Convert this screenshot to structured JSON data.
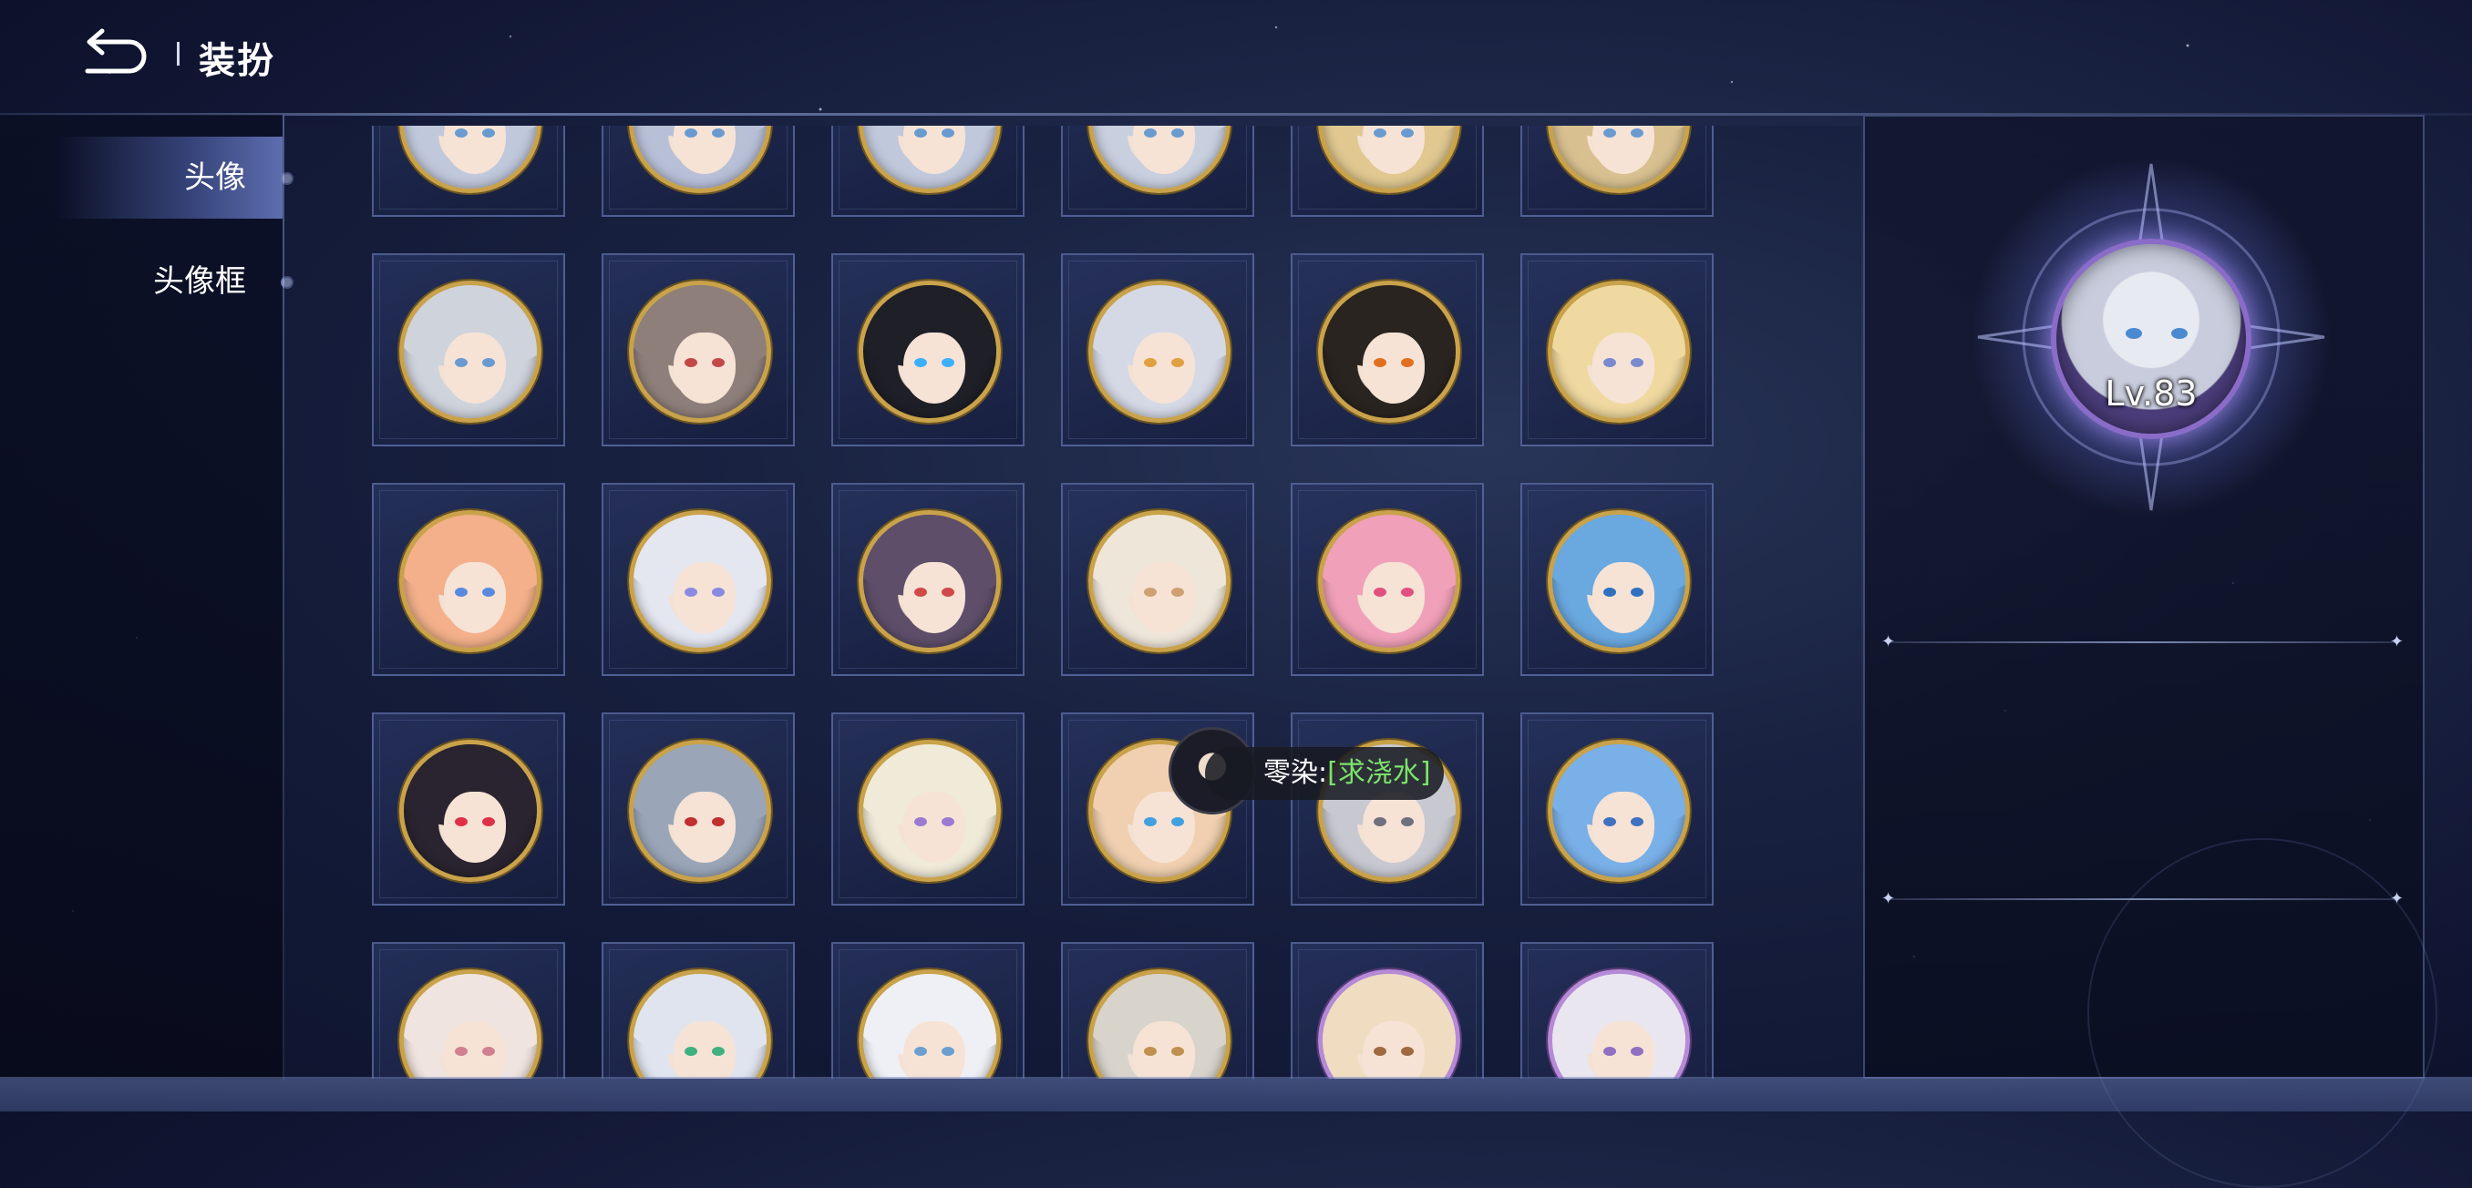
{
  "header": {
    "title": "装扮"
  },
  "sidebar": {
    "items": [
      {
        "label": "头像",
        "active": true
      },
      {
        "label": "头像框",
        "active": false
      }
    ]
  },
  "tooltip": {
    "name": "零染:",
    "tag": "[求浇水]"
  },
  "preview": {
    "level": "Lv.83"
  },
  "colors": {
    "accent": "#c9a24a",
    "tooltip_tag": "#7be36b",
    "panel_border": "#6e80be"
  },
  "avatars": [
    {
      "hair": "#cfd3dc",
      "eye": "#6a9bd0",
      "frame": "gold"
    },
    {
      "hair": "#8e7f7a",
      "eye": "#c24848",
      "frame": "gold"
    },
    {
      "hair": "#1f1f28",
      "eye": "#3bb0ff",
      "frame": "gold"
    },
    {
      "hair": "#d5d9e6",
      "eye": "#e0a040",
      "frame": "gold"
    },
    {
      "hair": "#2a2420",
      "eye": "#e07020",
      "frame": "gold"
    },
    {
      "hair": "#f0d9a0",
      "eye": "#7a8ad0",
      "frame": "gold"
    },
    {
      "hair": "#f3b08a",
      "eye": "#5a8ae0",
      "frame": "gold"
    },
    {
      "hair": "#e4e6f0",
      "eye": "#8a8ae0",
      "frame": "gold"
    },
    {
      "hair": "#5e4e6a",
      "eye": "#d04848",
      "frame": "gold"
    },
    {
      "hair": "#efe6da",
      "eye": "#d0a070",
      "frame": "gold"
    },
    {
      "hair": "#f0a0b8",
      "eye": "#e05080",
      "frame": "gold"
    },
    {
      "hair": "#6aa8e0",
      "eye": "#3070c0",
      "frame": "gold"
    },
    {
      "hair": "#2a2430",
      "eye": "#e03048",
      "frame": "gold"
    },
    {
      "hair": "#9aa6b8",
      "eye": "#c03030",
      "frame": "gold"
    },
    {
      "hair": "#f0ead8",
      "eye": "#9a7ad0",
      "frame": "gold"
    },
    {
      "hair": "#f0d0b0",
      "eye": "#40a0e0",
      "frame": "gold"
    },
    {
      "hair": "#c8c8d0",
      "eye": "#707080",
      "frame": "gold"
    },
    {
      "hair": "#7ab0e8",
      "eye": "#4070c0",
      "frame": "gold"
    },
    {
      "hair": "#f0e4e0",
      "eye": "#d08090",
      "frame": "gold"
    },
    {
      "hair": "#e0e4ee",
      "eye": "#40b080",
      "frame": "gold"
    },
    {
      "hair": "#eef0f6",
      "eye": "#6aa0d0",
      "frame": "gold"
    },
    {
      "hair": "#d8d4cc",
      "eye": "#c09050",
      "frame": "gold"
    },
    {
      "hair": "#f0dcc0",
      "eye": "#a06a40",
      "frame": "purple"
    },
    {
      "hair": "#eae6f0",
      "eye": "#9070c0",
      "frame": "purple"
    }
  ]
}
